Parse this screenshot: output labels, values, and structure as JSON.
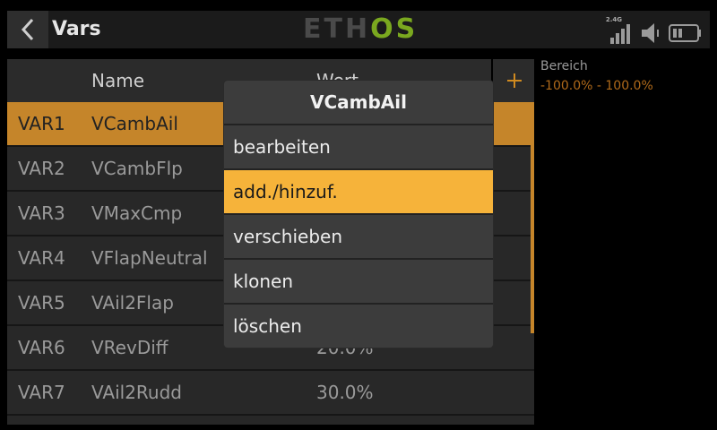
{
  "header": {
    "title": "Vars",
    "logo_left": "ETH",
    "logo_right": "OS",
    "freq": "2.4G"
  },
  "table": {
    "col_name": "Name",
    "col_value": "Wert",
    "add_label": "+",
    "rows": [
      {
        "id": "VAR1",
        "name": "VCambAil",
        "value": ""
      },
      {
        "id": "VAR2",
        "name": "VCambFlp",
        "value": ""
      },
      {
        "id": "VAR3",
        "name": "VMaxCmp",
        "value": ""
      },
      {
        "id": "VAR4",
        "name": "VFlapNeutral",
        "value": ""
      },
      {
        "id": "VAR5",
        "name": "VAil2Flap",
        "value": ""
      },
      {
        "id": "VAR6",
        "name": "VRevDiff",
        "value": "20.0%"
      },
      {
        "id": "VAR7",
        "name": "VAil2Rudd",
        "value": "30.0%"
      }
    ]
  },
  "info": {
    "range_label": "Bereich",
    "range_value": "-100.0% - 100.0%"
  },
  "popup": {
    "title": "VCambAil",
    "items": [
      {
        "label": "bearbeiten"
      },
      {
        "label": "add./hinzuf."
      },
      {
        "label": "verschieben"
      },
      {
        "label": "klonen"
      },
      {
        "label": "löschen"
      }
    ]
  },
  "colors": {
    "accent": "#f6b33a",
    "selected_row": "#c5852a",
    "logo_green": "#7aa81f"
  }
}
